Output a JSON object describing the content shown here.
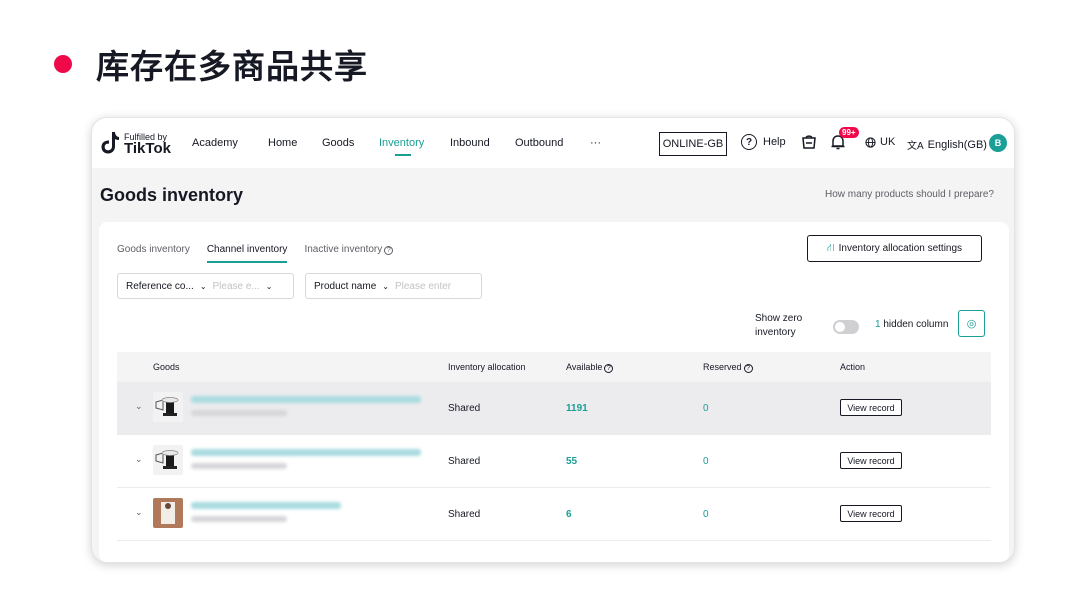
{
  "slide": {
    "title": "库存在多商品共享",
    "dot_color": "#f0094a"
  },
  "nav": {
    "logo_small": "Fulfilled by",
    "logo_big": "TikTok",
    "items": [
      "Academy",
      "Home",
      "Goods",
      "Inventory",
      "Inbound",
      "Outbound",
      "···"
    ],
    "active_item": "Inventory",
    "store": "ONLINE-GB",
    "help": "Help",
    "badge": "99+",
    "region": "UK",
    "language": "English(GB)",
    "avatar": "B"
  },
  "page": {
    "title": "Goods inventory",
    "prep_link": "How many products should I prepare?"
  },
  "tabs": [
    "Goods inventory",
    "Channel inventory",
    "Inactive inventory"
  ],
  "active_tab": "Channel inventory",
  "alloc_button": "Inventory allocation settings",
  "filters": {
    "ref_label": "Reference co...",
    "ref_placeholder": "Please e...",
    "product_label": "Product name",
    "product_placeholder": "Please enter"
  },
  "toolbar": {
    "show_zero": "Show zero inventory",
    "hidden_count": "1",
    "hidden_label": "hidden column"
  },
  "table": {
    "headers": [
      "Goods",
      "Inventory allocation",
      "Available",
      "Reserved",
      "Action"
    ],
    "rows": [
      {
        "allocation": "Shared",
        "available": "1191",
        "reserved": "0",
        "action": "View record"
      },
      {
        "allocation": "Shared",
        "available": "55",
        "reserved": "0",
        "action": "View record"
      },
      {
        "allocation": "Shared",
        "available": "6",
        "reserved": "0",
        "action": "View record"
      }
    ]
  },
  "colors": {
    "accent": "#1a9e96",
    "brand_red": "#f0094a"
  }
}
